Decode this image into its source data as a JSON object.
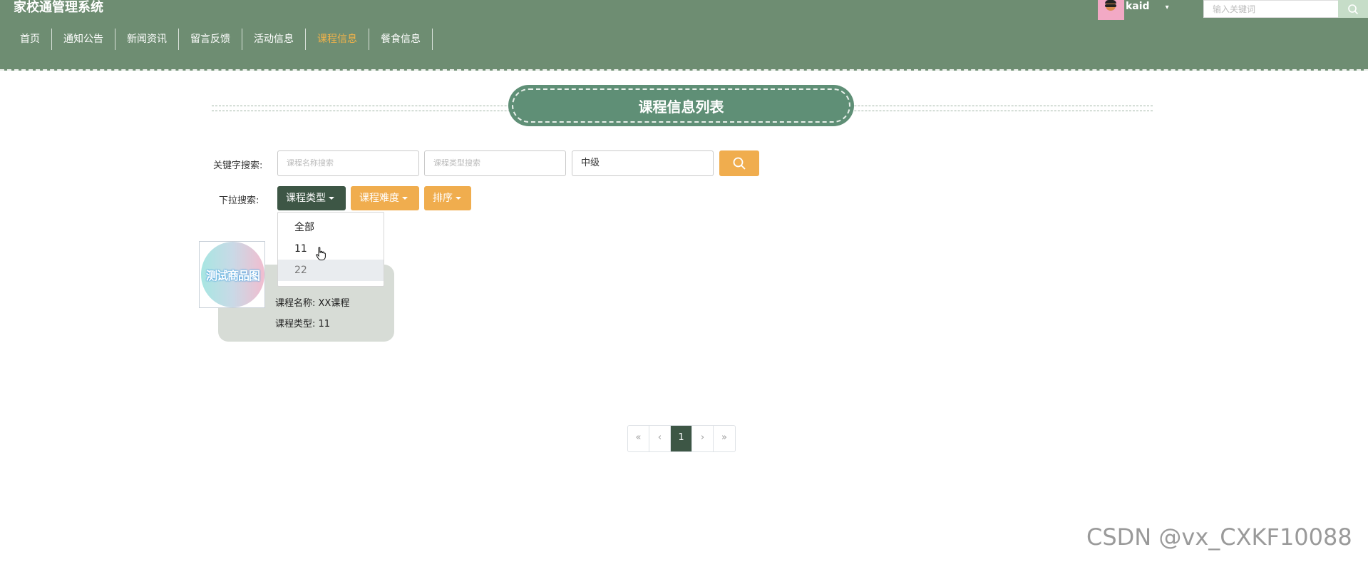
{
  "header": {
    "app_title": "家校通管理系统",
    "nav": [
      "首页",
      "通知公告",
      "新闻资讯",
      "留言反馈",
      "活动信息",
      "课程信息",
      "餐食信息"
    ],
    "active_nav_index": 5,
    "username": "kaid",
    "search_placeholder": "输入关键词"
  },
  "section": {
    "title": "课程信息列表"
  },
  "search": {
    "keyword_label": "关键字搜索:",
    "name_placeholder": "课程名称搜索",
    "type_placeholder": "课程类型搜索",
    "difficulty_value": "中级",
    "dropdown_label": "下拉搜索:",
    "dropdowns": [
      "课程类型",
      "课程难度",
      "排序"
    ]
  },
  "dropdown_menu": {
    "items": [
      "全部",
      "11",
      "22"
    ],
    "hovered_index": 2
  },
  "card": {
    "image_text": "测试商品图",
    "name_line": "课程名称: XX课程",
    "type_line": "课程类型: 11"
  },
  "pagination": {
    "first": "«",
    "prev": "‹",
    "current": "1",
    "next": "›",
    "last": "»"
  },
  "watermark": "CSDN @vx_CXKF10088",
  "colors": {
    "header_bg": "#6e8d72",
    "accent_orange": "#f0ad4e",
    "dark_green": "#3d5645",
    "title_green": "#5f8f76"
  }
}
